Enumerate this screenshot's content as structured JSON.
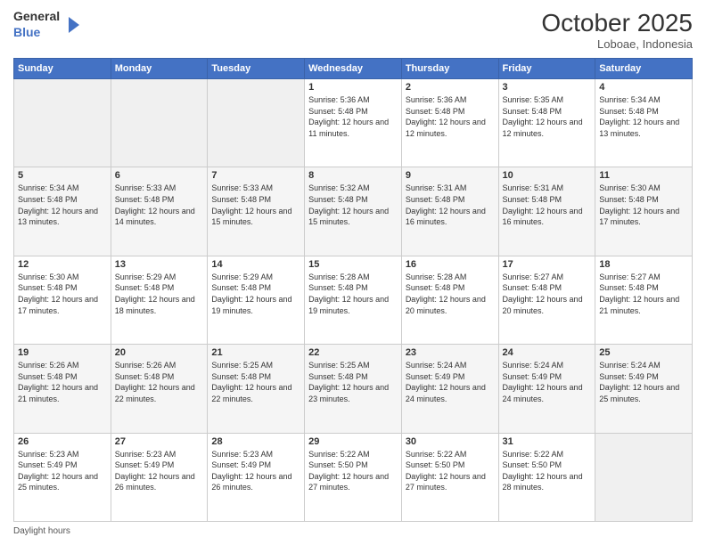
{
  "header": {
    "logo_general": "General",
    "logo_blue": "Blue",
    "month_title": "October 2025",
    "location": "Loboae, Indonesia"
  },
  "days_of_week": [
    "Sunday",
    "Monday",
    "Tuesday",
    "Wednesday",
    "Thursday",
    "Friday",
    "Saturday"
  ],
  "weeks": [
    [
      {
        "day": "",
        "sunrise": "",
        "sunset": "",
        "daylight": "",
        "empty": true
      },
      {
        "day": "",
        "sunrise": "",
        "sunset": "",
        "daylight": "",
        "empty": true
      },
      {
        "day": "",
        "sunrise": "",
        "sunset": "",
        "daylight": "",
        "empty": true
      },
      {
        "day": "1",
        "sunrise": "Sunrise: 5:36 AM",
        "sunset": "Sunset: 5:48 PM",
        "daylight": "Daylight: 12 hours and 11 minutes."
      },
      {
        "day": "2",
        "sunrise": "Sunrise: 5:36 AM",
        "sunset": "Sunset: 5:48 PM",
        "daylight": "Daylight: 12 hours and 12 minutes."
      },
      {
        "day": "3",
        "sunrise": "Sunrise: 5:35 AM",
        "sunset": "Sunset: 5:48 PM",
        "daylight": "Daylight: 12 hours and 12 minutes."
      },
      {
        "day": "4",
        "sunrise": "Sunrise: 5:34 AM",
        "sunset": "Sunset: 5:48 PM",
        "daylight": "Daylight: 12 hours and 13 minutes."
      }
    ],
    [
      {
        "day": "5",
        "sunrise": "Sunrise: 5:34 AM",
        "sunset": "Sunset: 5:48 PM",
        "daylight": "Daylight: 12 hours and 13 minutes."
      },
      {
        "day": "6",
        "sunrise": "Sunrise: 5:33 AM",
        "sunset": "Sunset: 5:48 PM",
        "daylight": "Daylight: 12 hours and 14 minutes."
      },
      {
        "day": "7",
        "sunrise": "Sunrise: 5:33 AM",
        "sunset": "Sunset: 5:48 PM",
        "daylight": "Daylight: 12 hours and 15 minutes."
      },
      {
        "day": "8",
        "sunrise": "Sunrise: 5:32 AM",
        "sunset": "Sunset: 5:48 PM",
        "daylight": "Daylight: 12 hours and 15 minutes."
      },
      {
        "day": "9",
        "sunrise": "Sunrise: 5:31 AM",
        "sunset": "Sunset: 5:48 PM",
        "daylight": "Daylight: 12 hours and 16 minutes."
      },
      {
        "day": "10",
        "sunrise": "Sunrise: 5:31 AM",
        "sunset": "Sunset: 5:48 PM",
        "daylight": "Daylight: 12 hours and 16 minutes."
      },
      {
        "day": "11",
        "sunrise": "Sunrise: 5:30 AM",
        "sunset": "Sunset: 5:48 PM",
        "daylight": "Daylight: 12 hours and 17 minutes."
      }
    ],
    [
      {
        "day": "12",
        "sunrise": "Sunrise: 5:30 AM",
        "sunset": "Sunset: 5:48 PM",
        "daylight": "Daylight: 12 hours and 17 minutes."
      },
      {
        "day": "13",
        "sunrise": "Sunrise: 5:29 AM",
        "sunset": "Sunset: 5:48 PM",
        "daylight": "Daylight: 12 hours and 18 minutes."
      },
      {
        "day": "14",
        "sunrise": "Sunrise: 5:29 AM",
        "sunset": "Sunset: 5:48 PM",
        "daylight": "Daylight: 12 hours and 19 minutes."
      },
      {
        "day": "15",
        "sunrise": "Sunrise: 5:28 AM",
        "sunset": "Sunset: 5:48 PM",
        "daylight": "Daylight: 12 hours and 19 minutes."
      },
      {
        "day": "16",
        "sunrise": "Sunrise: 5:28 AM",
        "sunset": "Sunset: 5:48 PM",
        "daylight": "Daylight: 12 hours and 20 minutes."
      },
      {
        "day": "17",
        "sunrise": "Sunrise: 5:27 AM",
        "sunset": "Sunset: 5:48 PM",
        "daylight": "Daylight: 12 hours and 20 minutes."
      },
      {
        "day": "18",
        "sunrise": "Sunrise: 5:27 AM",
        "sunset": "Sunset: 5:48 PM",
        "daylight": "Daylight: 12 hours and 21 minutes."
      }
    ],
    [
      {
        "day": "19",
        "sunrise": "Sunrise: 5:26 AM",
        "sunset": "Sunset: 5:48 PM",
        "daylight": "Daylight: 12 hours and 21 minutes."
      },
      {
        "day": "20",
        "sunrise": "Sunrise: 5:26 AM",
        "sunset": "Sunset: 5:48 PM",
        "daylight": "Daylight: 12 hours and 22 minutes."
      },
      {
        "day": "21",
        "sunrise": "Sunrise: 5:25 AM",
        "sunset": "Sunset: 5:48 PM",
        "daylight": "Daylight: 12 hours and 22 minutes."
      },
      {
        "day": "22",
        "sunrise": "Sunrise: 5:25 AM",
        "sunset": "Sunset: 5:48 PM",
        "daylight": "Daylight: 12 hours and 23 minutes."
      },
      {
        "day": "23",
        "sunrise": "Sunrise: 5:24 AM",
        "sunset": "Sunset: 5:49 PM",
        "daylight": "Daylight: 12 hours and 24 minutes."
      },
      {
        "day": "24",
        "sunrise": "Sunrise: 5:24 AM",
        "sunset": "Sunset: 5:49 PM",
        "daylight": "Daylight: 12 hours and 24 minutes."
      },
      {
        "day": "25",
        "sunrise": "Sunrise: 5:24 AM",
        "sunset": "Sunset: 5:49 PM",
        "daylight": "Daylight: 12 hours and 25 minutes."
      }
    ],
    [
      {
        "day": "26",
        "sunrise": "Sunrise: 5:23 AM",
        "sunset": "Sunset: 5:49 PM",
        "daylight": "Daylight: 12 hours and 25 minutes."
      },
      {
        "day": "27",
        "sunrise": "Sunrise: 5:23 AM",
        "sunset": "Sunset: 5:49 PM",
        "daylight": "Daylight: 12 hours and 26 minutes."
      },
      {
        "day": "28",
        "sunrise": "Sunrise: 5:23 AM",
        "sunset": "Sunset: 5:49 PM",
        "daylight": "Daylight: 12 hours and 26 minutes."
      },
      {
        "day": "29",
        "sunrise": "Sunrise: 5:22 AM",
        "sunset": "Sunset: 5:50 PM",
        "daylight": "Daylight: 12 hours and 27 minutes."
      },
      {
        "day": "30",
        "sunrise": "Sunrise: 5:22 AM",
        "sunset": "Sunset: 5:50 PM",
        "daylight": "Daylight: 12 hours and 27 minutes."
      },
      {
        "day": "31",
        "sunrise": "Sunrise: 5:22 AM",
        "sunset": "Sunset: 5:50 PM",
        "daylight": "Daylight: 12 hours and 28 minutes."
      },
      {
        "day": "",
        "sunrise": "",
        "sunset": "",
        "daylight": "",
        "empty": true
      }
    ]
  ],
  "footer": {
    "daylight_label": "Daylight hours"
  }
}
